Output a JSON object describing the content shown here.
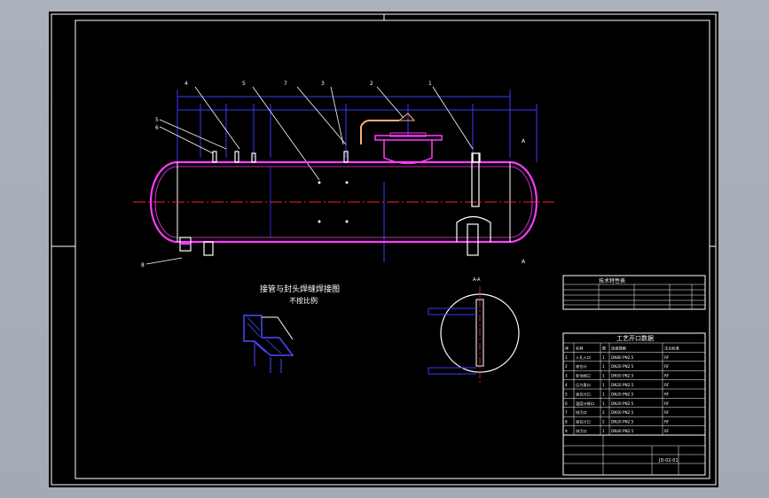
{
  "drawing": {
    "detail_title": "接管与封头焊缝焊接图",
    "detail_scale": "不按比例",
    "section_label": "A-A",
    "cut_marker_top": "A",
    "cut_marker_bottom": "A",
    "balloons": [
      "4",
      "5",
      "7",
      "3",
      "2",
      "1",
      "5",
      "6",
      "8"
    ]
  },
  "tech_table": {
    "title": "技术特性表"
  },
  "nozzle_table": {
    "title": "工艺开口数据",
    "headers": [
      "序",
      "名称",
      "数",
      "连接规格",
      "法兰标准"
    ],
    "rows": [
      [
        "1",
        "人孔入口",
        "1",
        "DN80 PN2.5",
        "RF"
      ],
      [
        "2",
        "液位计",
        "1",
        "DN20 PN2.5",
        "RF"
      ],
      [
        "3",
        "安全阀口",
        "1",
        "DN50 PN2.5",
        "RF"
      ],
      [
        "4",
        "压力表口",
        "1",
        "DN20 PN2.5",
        "RF"
      ],
      [
        "5",
        "液位计口",
        "1",
        "DN20 PN2.5",
        "RF"
      ],
      [
        "6",
        "温度计接口",
        "1",
        "DN20 PN2.5",
        "RF"
      ],
      [
        "7",
        "排污口",
        "2",
        "DN50 PN2.5",
        "RF"
      ],
      [
        "8",
        "液位计口",
        "2",
        "DN20 PN2.5",
        "RF"
      ],
      [
        "9",
        "排污口",
        "1",
        "DN40 PN2.5",
        "RF"
      ]
    ]
  },
  "title_block": {
    "drawing_no": "JD-02-01"
  },
  "colors": {
    "vessel": "#ff3cff",
    "dimension": "#3a3aff",
    "centerline": "#ff2020",
    "frame": "#ffffff",
    "nozzle": "#ffffff",
    "hatch": "#4a4aff"
  }
}
